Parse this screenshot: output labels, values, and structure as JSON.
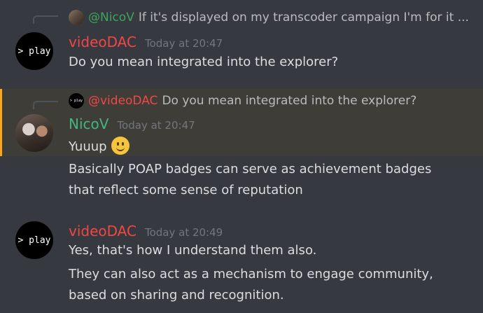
{
  "colors": {
    "videodac": "#f04747",
    "nicov": "#43b581",
    "mention": "#3ba55c"
  },
  "messages": [
    {
      "reply": {
        "avatar_icon": "nicov-photo",
        "name": "@NicoV",
        "text": "If it's displayed on my transcoder campaign I'm for it ..."
      },
      "author": "videoDAC",
      "avatar_text": "> play",
      "time": "Today at 20:47",
      "lines": [
        "Do you mean integrated into the explorer?"
      ]
    },
    {
      "reply": {
        "avatar_text": "> play",
        "name": "@videoDAC",
        "text": "Do you mean integrated into the explorer?"
      },
      "author": "NicoV",
      "avatar_icon": "nicov-photo",
      "time": "Today at 20:47",
      "lines": [
        "Yuuup",
        "Basically POAP badges can serve as achievement badges",
        "that reflect some sense of reputation"
      ],
      "emoji": "slightly-smiling-face"
    },
    {
      "author": "videoDAC",
      "avatar_text": "> play",
      "time": "Today at 20:49",
      "lines": [
        "Yes, that's how I understand them also.",
        "They can also act as a mechanism to engage community,",
        "based on sharing and recognition."
      ]
    }
  ]
}
